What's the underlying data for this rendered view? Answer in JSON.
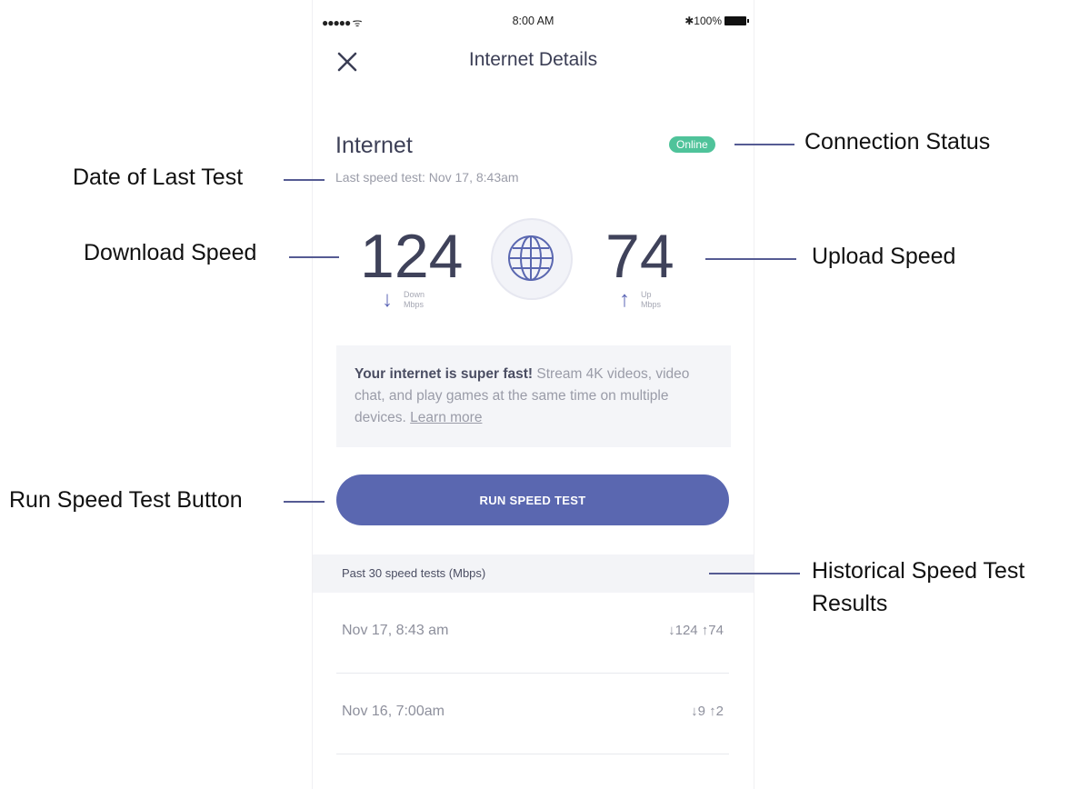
{
  "status_bar": {
    "signal": "●●●●● ᯤ",
    "time": "8:00 AM",
    "battery": "✱100%"
  },
  "nav": {
    "title": "Internet Details"
  },
  "internet": {
    "title": "Internet",
    "status": "Online",
    "last_test": "Last speed test: Nov 17, 8:43am"
  },
  "download": {
    "value": "124",
    "arrow": "↓",
    "label1": "Down",
    "label2": "Mbps"
  },
  "upload": {
    "value": "74",
    "arrow": "↑",
    "label1": "Up",
    "label2": "Mbps"
  },
  "info": {
    "bold": "Your internet is super fast!",
    "text": " Stream 4K videos, video chat, and play games at the same time on multiple devices. ",
    "link": "Learn more"
  },
  "run_button": {
    "label": "RUN SPEED TEST"
  },
  "history": {
    "header": "Past 30 speed tests (Mbps)",
    "rows": [
      {
        "date": "Nov 17, 8:43 am",
        "values": "↓124 ↑74"
      },
      {
        "date": "Nov 16, 7:00am",
        "values": "↓9 ↑2"
      }
    ]
  },
  "annotations": {
    "connection_status": "Connection Status",
    "date_last_test": "Date of Last Test",
    "download_speed": "Download Speed",
    "upload_speed": "Upload Speed",
    "run_speed_test_button": "Run Speed Test Button",
    "historical_line1": "Historical Speed Test",
    "historical_line2": "Results"
  },
  "colors": {
    "accent": "#5a67b0",
    "online": "#4fc39a",
    "annotation_line": "#555b93"
  }
}
